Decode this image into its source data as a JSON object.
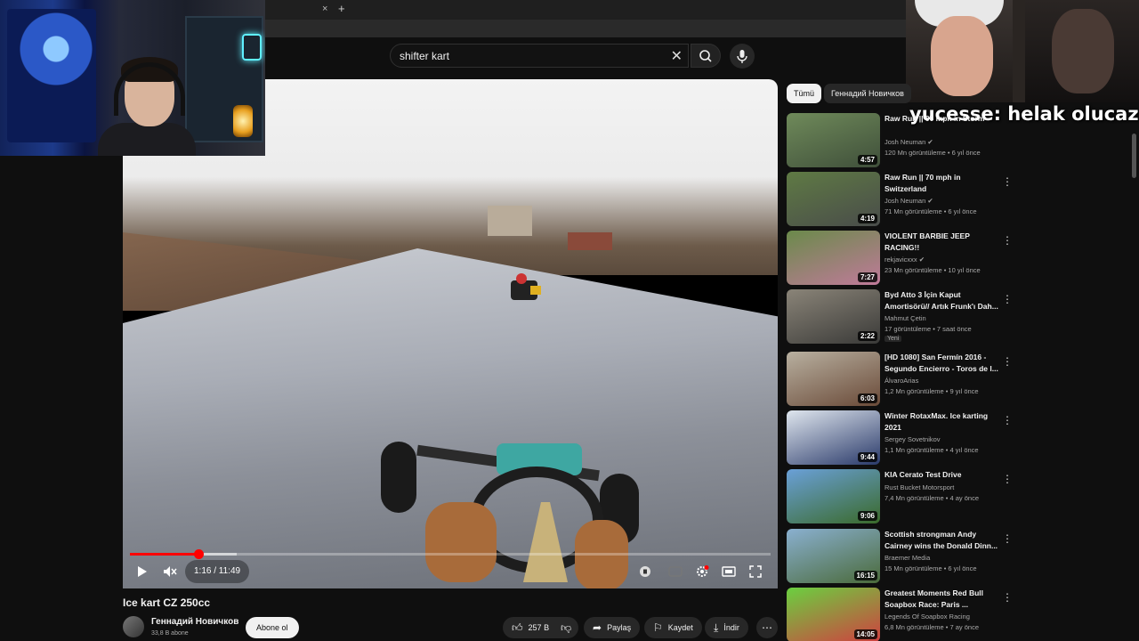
{
  "browser": {
    "tab_close": "×",
    "new_tab": "+"
  },
  "search": {
    "value": "shifter kart",
    "clear": "✕"
  },
  "chat": {
    "user": "yucesse",
    "message": "helak olucaz",
    "line": "yucesse: helak olucaz"
  },
  "player": {
    "current_time": "1:16",
    "duration": "11:49",
    "time_label": "1:16 / 11:49",
    "played_fraction": 0.107,
    "loaded_fraction": 0.167
  },
  "video": {
    "title": "Ice kart CZ 250cc",
    "channel": "Геннадий Новичков",
    "subscribers": "33,8 B abone",
    "subscribe_label": "Abone ol",
    "likes": "257 B",
    "share_label": "Paylaş",
    "save_label": "Kaydet",
    "download_label": "İndir"
  },
  "chips": [
    "Tümü",
    "Геннадий Новичков"
  ],
  "recommendations": [
    {
      "title": "Raw Run || 90 mph in Storm",
      "channel": "Josh Neuman",
      "verified": true,
      "meta": "120 Mn görüntüleme • 6 yıl önce",
      "duration": "4:57",
      "colors": [
        "#6f8a5a",
        "#3f4f3a"
      ]
    },
    {
      "title": "Raw Run || 70 mph in Switzerland",
      "channel": "Josh Neuman",
      "verified": true,
      "meta": "71 Mn görüntüleme • 6 yıl önce",
      "duration": "4:19",
      "colors": [
        "#5f7a44",
        "#494c4a"
      ]
    },
    {
      "title": "VIOLENT BARBIE JEEP RACING!!",
      "channel": "rekjavicxxx",
      "verified": true,
      "meta": "23 Mn görüntüleme • 10 yıl önce",
      "duration": "7:27",
      "colors": [
        "#6a8a4a",
        "#c07a9a"
      ]
    },
    {
      "title": "Byd Atto 3 İçin Kaput Amortisörü// Artık Frunk'ı Dah...",
      "channel": "Mahmut Çetin",
      "verified": false,
      "meta": "17 görüntüleme • 7 saat önce",
      "badge": "Yeni",
      "duration": "2:22",
      "colors": [
        "#8a8478",
        "#3a3a38"
      ]
    },
    {
      "title": "[HD 1080] San Fermín 2016 - Segundo Encierro - Toros de l...",
      "channel": "ÁlvaroArias",
      "verified": false,
      "meta": "1,2 Mn görüntüleme • 9 yıl önce",
      "duration": "6:03",
      "colors": [
        "#b8b0a0",
        "#6a4a38"
      ]
    },
    {
      "title": "Winter RotaxMax. Ice karting 2021",
      "channel": "Sergey Sovetnikov",
      "verified": false,
      "meta": "1,1 Mn görüntüleme • 4 yıl önce",
      "duration": "9:44",
      "colors": [
        "#dfe6ee",
        "#2a3a6a"
      ]
    },
    {
      "title": "KIA Cerato Test Drive",
      "channel": "Rust Bucket Motorsport",
      "verified": false,
      "meta": "7,4 Mn görüntüleme • 4 ay önce",
      "duration": "9:06",
      "colors": [
        "#6aa0d8",
        "#3a6a2a"
      ]
    },
    {
      "title": "Scottish strongman Andy Cairney wins the Donald Dinn...",
      "channel": "Braemer Media",
      "verified": false,
      "meta": "15 Mn görüntüleme • 6 yıl önce",
      "duration": "16:15",
      "colors": [
        "#8ab0d0",
        "#4a6a3a"
      ]
    },
    {
      "title": "Greatest Moments Red Bull Soapbox Race: Paris ...",
      "channel": "Legends Of Soapbox Racing",
      "verified": false,
      "meta": "6,8 Mn görüntüleme • 7 ay önce",
      "duration": "14:05",
      "colors": [
        "#6ad040",
        "#d04040"
      ]
    }
  ]
}
